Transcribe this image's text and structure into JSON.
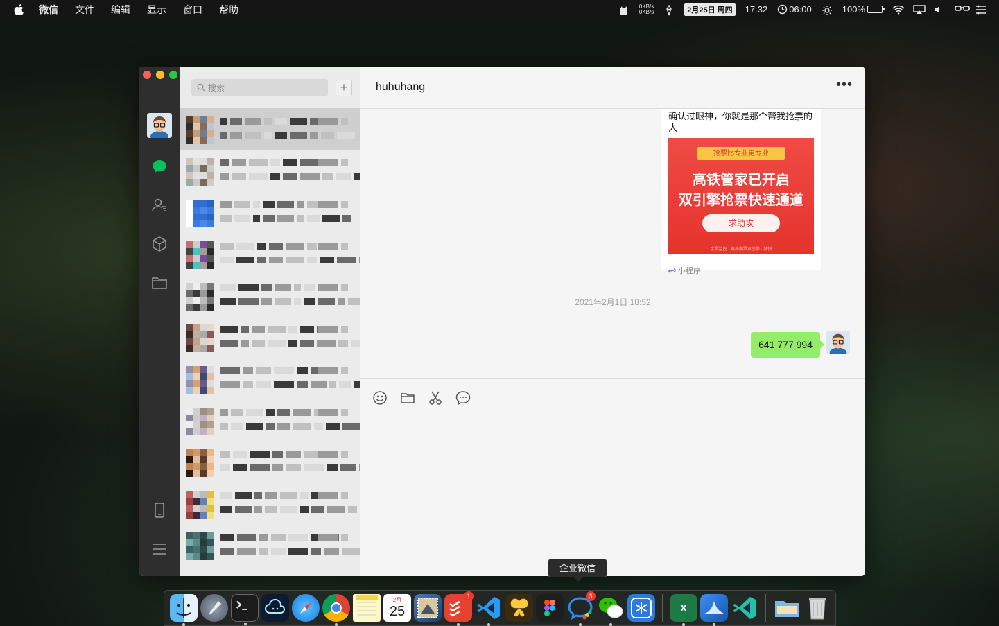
{
  "menubar": {
    "apple": "",
    "items": [
      "微信",
      "文件",
      "编辑",
      "显示",
      "窗口",
      "帮助"
    ],
    "netspeed_up": "0KB/s",
    "netspeed_down": "0KB/s",
    "date": "2月25日 周四",
    "time": "17:32",
    "timer": "06:00",
    "battery": "100%"
  },
  "search": {
    "placeholder": "搜索"
  },
  "chat": {
    "title": "huhuhang",
    "mini_program": {
      "text": "确认过眼神，你就是那个帮我抢票的人",
      "tag": "抢票比专业更专业",
      "headline1": "高铁管家已开启",
      "headline2": "双引擎抢票快速通道",
      "button": "求助攻",
      "footer": "余票监控 · 候补购票双引擎 · 够快",
      "source": "小程序"
    },
    "timestamp": "2021年2月1日 18:52",
    "message": "641 777 994"
  },
  "dock": {
    "tooltip": "企业微信",
    "calendar_day": "25",
    "calendar_month": "2月",
    "todoist_badge": "1",
    "wecom_badge": "3"
  },
  "colors": {
    "bubble": "#95ec69",
    "sidebar": "#2e2e2e",
    "wechat_green": "#07c160",
    "mini_red": "#e5332d"
  }
}
